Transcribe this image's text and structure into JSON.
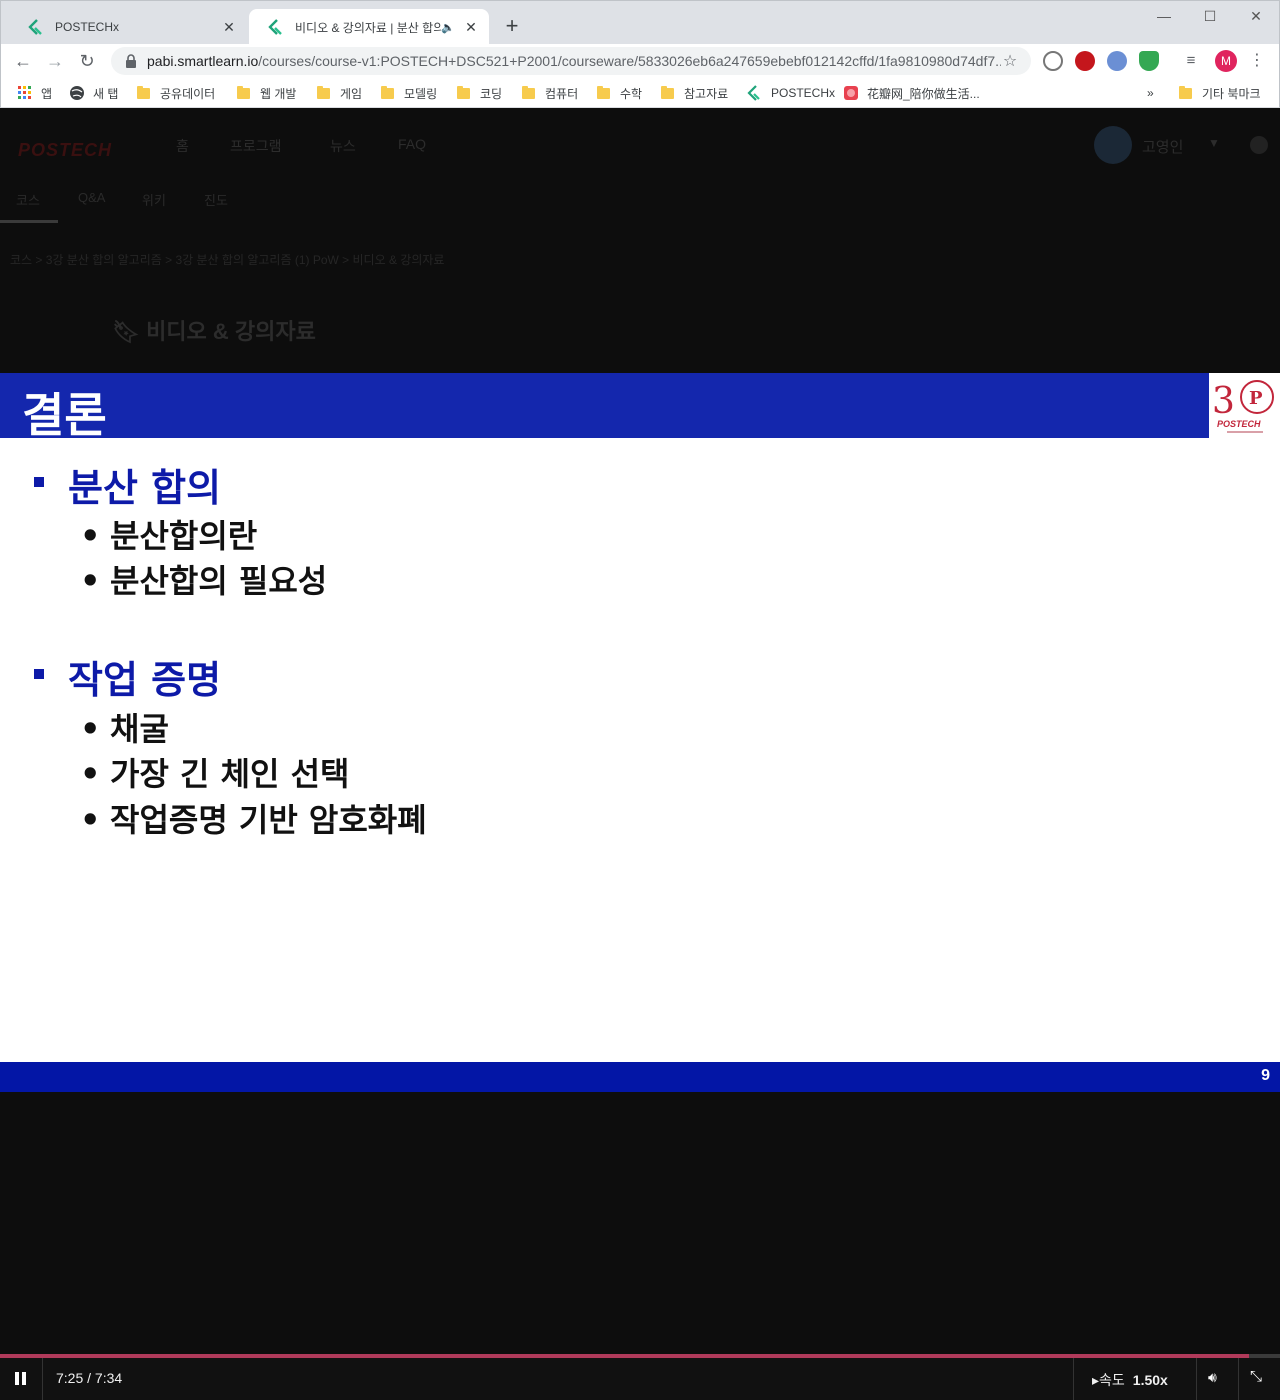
{
  "browser": {
    "tabs": [
      {
        "title": "POSTECHx",
        "active": false
      },
      {
        "title": "비디오 & 강의자료 | 분산 합의",
        "active": true,
        "audio": true
      }
    ],
    "url_host": "pabi.smartlearn.io",
    "url_path": "/courses/course-v1:POSTECH+DSC521+P2001/courseware/5833026eb6a247659ebebf012142cffd/1fa9810980d74df7...",
    "profile_initial": "M",
    "bookmarks": [
      {
        "label": "앱",
        "icon": "apps-grid-icon"
      },
      {
        "label": "새 탭",
        "icon": "globe-icon"
      },
      {
        "label": "공유데이터",
        "icon": "folder-icon"
      },
      {
        "label": "웹 개발",
        "icon": "folder-icon"
      },
      {
        "label": "게임",
        "icon": "folder-icon"
      },
      {
        "label": "모델링",
        "icon": "folder-icon"
      },
      {
        "label": "코딩",
        "icon": "folder-icon"
      },
      {
        "label": "컴퓨터",
        "icon": "folder-icon"
      },
      {
        "label": "수학",
        "icon": "folder-icon"
      },
      {
        "label": "참고자료",
        "icon": "folder-icon"
      },
      {
        "label": "POSTECHx",
        "icon": "postechx-icon"
      },
      {
        "label": "花瓣网_陪你做生活...",
        "icon": "huaban-icon"
      }
    ],
    "bookmarks_overflow": "»",
    "other_bookmarks": "기타 북마크"
  },
  "site": {
    "logo": "POSTECH",
    "nav": [
      "홈",
      "프로그램",
      "뉴스",
      "FAQ"
    ],
    "username": "고영인",
    "subnav": [
      "코스",
      "Q&A",
      "위키",
      "진도"
    ],
    "breadcrumb": "코스  >  3강 분산 합의 알고리즘  >  3강 분산 합의 알고리즘 (1) PoW  >  비디오 & 강의자료",
    "heading": "비디오 & 강의자료"
  },
  "slide": {
    "title": "결론",
    "sections": [
      {
        "heading": "분산 합의",
        "items": [
          "분산합의란",
          "분산합의 필요성"
        ]
      },
      {
        "heading": "작업 증명",
        "items": [
          "채굴",
          "가장 긴 체인 선택",
          "작업증명 기반 암호화폐"
        ]
      }
    ],
    "page_number": "9",
    "logo_text": "POSTECH",
    "accent_color": "#1427ad"
  },
  "player": {
    "time": "7:25 / 7:34",
    "progress_fraction": 0.976,
    "speed_label": "속도",
    "speed_value": "1.50x",
    "progress_color": "#b03a5a"
  }
}
